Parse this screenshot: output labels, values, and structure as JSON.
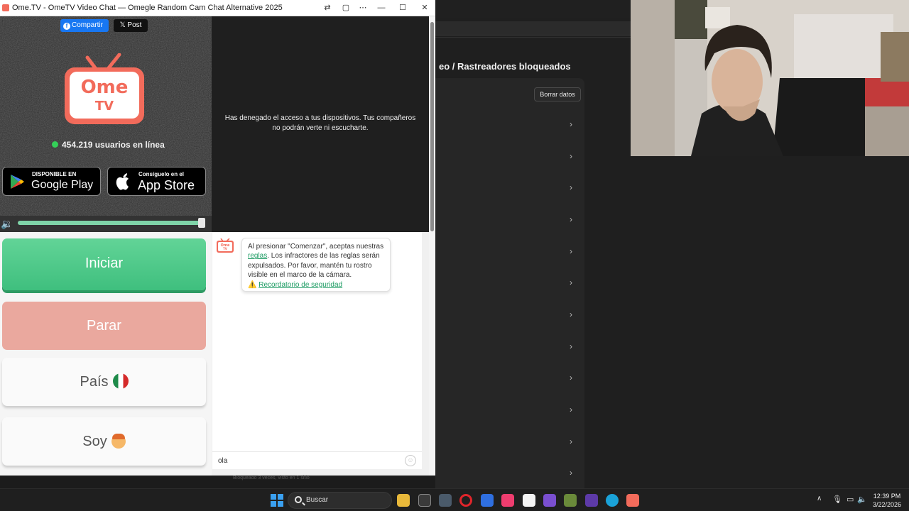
{
  "window": {
    "title": "Ome.TV - OmeTV Video Chat — Omegle Random Cam Chat Alternative 2025"
  },
  "share": {
    "facebook_label": "Compartir",
    "x_label": "Post"
  },
  "logo": {
    "line1": "Ome",
    "line2": "TV"
  },
  "online": {
    "count_text": "454.219 usuarios en línea"
  },
  "stores": {
    "google_small": "DISPONIBLE EN",
    "google_big": "Google Play",
    "apple_small": "Consíguelo en el",
    "apple_big": "App Store"
  },
  "volume": {
    "level": 1.0
  },
  "remote_video": {
    "message": "Has denegado el acceso a tus dispositivos. Tus compañeros no podrán verte ni escucharte."
  },
  "buttons": {
    "start": "Iniciar",
    "stop": "Parar",
    "country": "País",
    "gender": "Soy"
  },
  "chat": {
    "bubble_pre": "Al presionar \"Comenzar\", aceptas nuestras ",
    "bubble_link": "reglas",
    "bubble_post": ". Los infractores de las reglas serán expulsados. Por favor, mantén tu rostro visible en el marco de la cámara.",
    "safety_link": "Recordatorio de seguridad",
    "input_value": "ola"
  },
  "background_page": {
    "breadcrumb": "eo  /  Rastreadores bloqueados",
    "clear_button": "Borrar datos",
    "footnote": "Bloqueado 3 veces, visto en 1 sitio"
  },
  "taskbar": {
    "search_label": "Buscar",
    "time": "12:39 PM",
    "date": "3/22/2026"
  },
  "colors": {
    "start_green": "#4cc98a",
    "stop_red": "#eaa89e",
    "facebook_blue": "#1877f2",
    "logo_red": "#f26b5b"
  }
}
